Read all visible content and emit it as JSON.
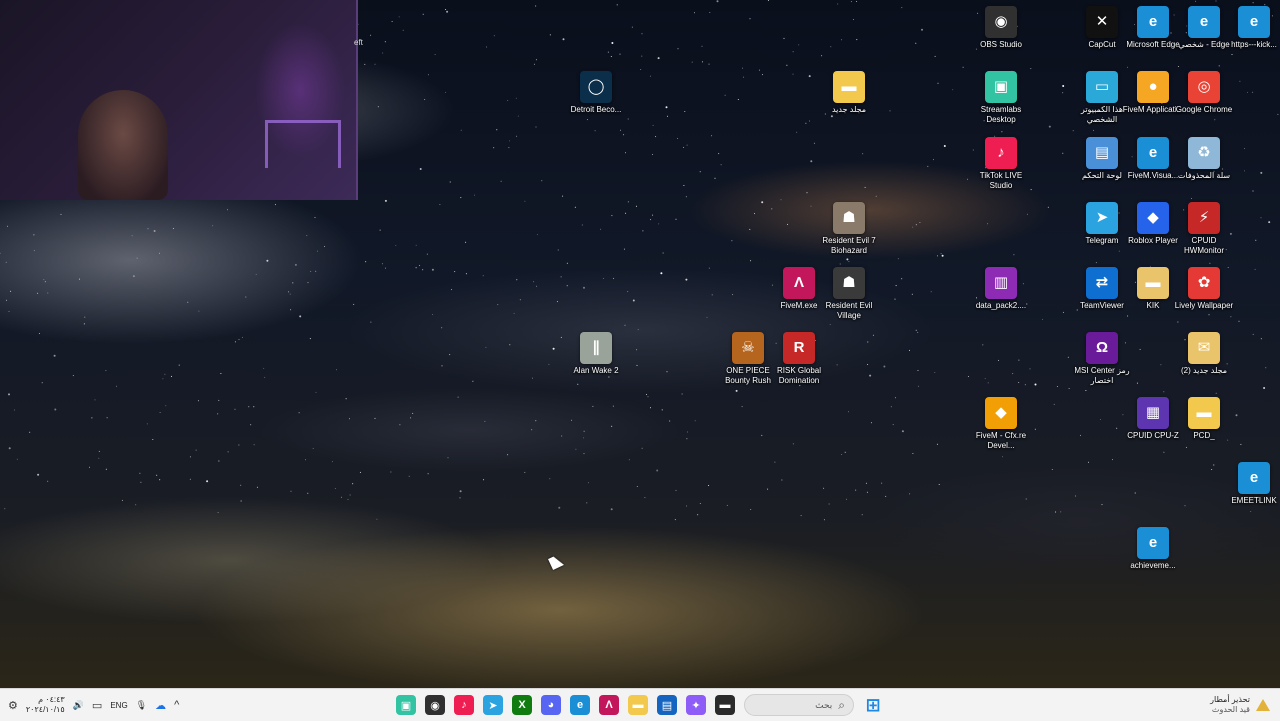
{
  "desktop": {
    "icons": [
      {
        "id": "obs",
        "label": "OBS Studio",
        "glyph": "◉",
        "color": "#303030"
      },
      {
        "id": "capcut",
        "label": "CapCut",
        "glyph": "✕",
        "color": "#111111"
      },
      {
        "id": "edge1",
        "label": "Microsoft Edge",
        "glyph": "e",
        "color": "#1a8fd6"
      },
      {
        "id": "edge2",
        "label": "شخصي - Edge",
        "glyph": "e",
        "color": "#1a8fd6"
      },
      {
        "id": "kick",
        "label": "https---kick...",
        "glyph": "e",
        "color": "#1a8fd6"
      },
      {
        "id": "detroit",
        "label": "Detroit Beco...",
        "glyph": "◯",
        "color": "#0b2f4a"
      },
      {
        "id": "newfolder1",
        "label": "مجلد جديد",
        "glyph": "▬",
        "color": "#f2c94c"
      },
      {
        "id": "streamlabs",
        "label": "Streamlabs Desktop",
        "glyph": "▣",
        "color": "#31c3a2"
      },
      {
        "id": "thispc",
        "label": "هذا الكمبيوتر الشخصي",
        "glyph": "▭",
        "color": "#2aa8d8"
      },
      {
        "id": "fivemapp",
        "label": "FiveM Applicati...",
        "glyph": "●",
        "color": "#f5a623"
      },
      {
        "id": "chrome",
        "label": "Google Chrome",
        "glyph": "◎",
        "color": "#e94335"
      },
      {
        "id": "tiktok",
        "label": "TikTok LIVE Studio",
        "glyph": "♪",
        "color": "#ee1d52"
      },
      {
        "id": "controlpanel",
        "label": "لوحة التحكم",
        "glyph": "▤",
        "color": "#4a90d9"
      },
      {
        "id": "fivemvisual",
        "label": "FiveM.Visua...",
        "glyph": "e",
        "color": "#1a8fd6"
      },
      {
        "id": "recycle",
        "label": "سلة المحذوفات",
        "glyph": "♻",
        "color": "#8fb8d8"
      },
      {
        "id": "re7",
        "label": "Resident Evil 7 Biohazard",
        "glyph": "☗",
        "color": "#8a7a6a"
      },
      {
        "id": "telegram",
        "label": "Telegram",
        "glyph": "➤",
        "color": "#2aa3e0"
      },
      {
        "id": "roblox",
        "label": "Roblox Player",
        "glyph": "◆",
        "color": "#2563eb"
      },
      {
        "id": "hwmonitor",
        "label": "CPUID HWMonitor",
        "glyph": "⚡",
        "color": "#c62828"
      },
      {
        "id": "fivemexe",
        "label": "FiveM.exe",
        "glyph": "Λ",
        "color": "#c2185b"
      },
      {
        "id": "revillage",
        "label": "Resident Evil Village",
        "glyph": "☗",
        "color": "#3a3a3a"
      },
      {
        "id": "datapack",
        "label": "data_pack2....",
        "glyph": "▥",
        "color": "#8e2bb5"
      },
      {
        "id": "teamviewer",
        "label": "TeamViewer",
        "glyph": "⇄",
        "color": "#0e6fd1"
      },
      {
        "id": "kik",
        "label": "KIK",
        "glyph": "▬",
        "color": "#e9c46a"
      },
      {
        "id": "lively",
        "label": "Lively Wallpaper",
        "glyph": "✿",
        "color": "#e53935"
      },
      {
        "id": "alanwake",
        "label": "Alan Wake 2",
        "glyph": "∥",
        "color": "#9aa39a"
      },
      {
        "id": "onepiece",
        "label": "ONE PIECE Bounty Rush",
        "glyph": "☠",
        "color": "#b5651d"
      },
      {
        "id": "risk",
        "label": "RISK Global Domination",
        "glyph": "R",
        "color": "#c62828"
      },
      {
        "id": "msicenter",
        "label": "MSI Center رمز اختصار",
        "glyph": "Ω",
        "color": "#6a1b9a"
      },
      {
        "id": "newfolder2",
        "label": "(2) مجلد جديد",
        "glyph": "✉",
        "color": "#e9c46a"
      },
      {
        "id": "fivemcfx",
        "label": "FiveM - Cfx.re Devel...",
        "glyph": "◆",
        "color": "#f29f05"
      },
      {
        "id": "cpuz",
        "label": "CPUID CPU-Z",
        "glyph": "▦",
        "color": "#5e35b1"
      },
      {
        "id": "pcd",
        "label": "PCD_",
        "glyph": "▬",
        "color": "#f2c94c"
      },
      {
        "id": "emeetlink",
        "label": "EMEETLINK",
        "glyph": "e",
        "color": "#1a8fd6"
      },
      {
        "id": "achieveme",
        "label": "achieveme...",
        "glyph": "e",
        "color": "#1a8fd6"
      }
    ],
    "webcam_partial_text": "eft"
  },
  "taskbar": {
    "left": {
      "settings_glyph": "⚙",
      "time": "٠٤:٤٣ م",
      "date": "٢٠٢٤/١٠/١٥",
      "volume_glyph": "🔊",
      "language": "ENG",
      "wifi_glyph": "▭",
      "mic_glyph": "🎙",
      "onedrive_glyph": "☁",
      "chevron_glyph": "^"
    },
    "apps": [
      {
        "id": "streamlabs",
        "glyph": "▣",
        "color": "#31c3a2"
      },
      {
        "id": "obs",
        "glyph": "◉",
        "color": "#303030"
      },
      {
        "id": "tiktok",
        "glyph": "♪",
        "color": "#ee1d52"
      },
      {
        "id": "telegram",
        "glyph": "➤",
        "color": "#2aa3e0"
      },
      {
        "id": "xbox",
        "glyph": "X",
        "color": "#107c10"
      },
      {
        "id": "discord",
        "glyph": "◕",
        "color": "#5865f2"
      },
      {
        "id": "edge",
        "glyph": "e",
        "color": "#1a8fd6"
      },
      {
        "id": "fivem",
        "glyph": "Λ",
        "color": "#c2185b"
      },
      {
        "id": "explorer",
        "glyph": "▬",
        "color": "#f2c94c"
      },
      {
        "id": "store",
        "glyph": "▤",
        "color": "#1565c0"
      },
      {
        "id": "copilot",
        "glyph": "✦",
        "color": "#8e5cf7"
      },
      {
        "id": "terminal",
        "glyph": "▬",
        "color": "#2b2b2b"
      }
    ],
    "search_placeholder": "بحث",
    "search_glyph": "⌕",
    "start_glyph": "⊞",
    "weather_title": "تحذير أمطار",
    "weather_subtitle": "قيد الحدوث",
    "warning_glyph": "!"
  }
}
